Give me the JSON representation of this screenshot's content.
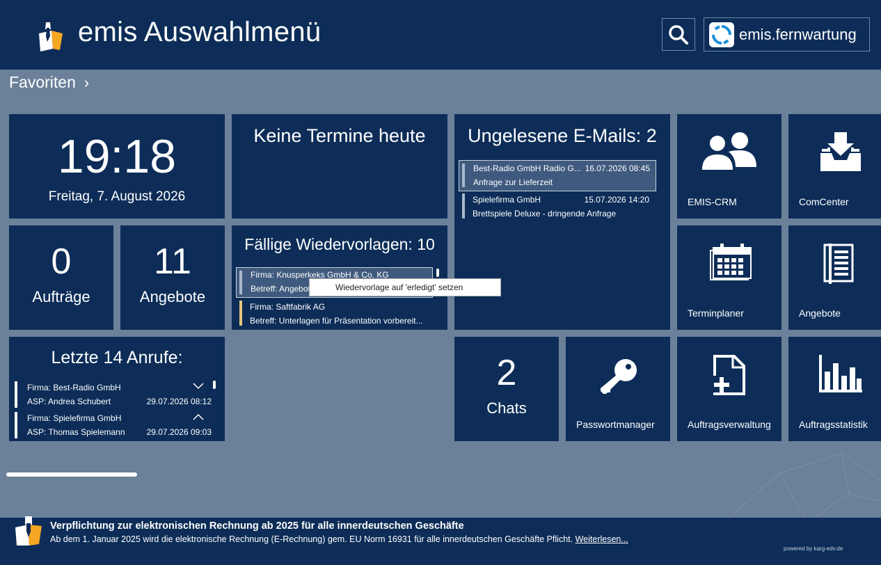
{
  "header": {
    "title": "emis Auswahlmenü",
    "remote_label": "emis.fernwartung"
  },
  "favorites": {
    "label": "Favoriten",
    "chevron": "›"
  },
  "clock": {
    "time": "19:18",
    "date": "Freitag, 7. August 2026"
  },
  "appointments": {
    "title": "Keine Termine heute"
  },
  "emails": {
    "title": "Ungelesene E-Mails: 2",
    "items": [
      {
        "sender": "Best-Radio GmbH Radio G...",
        "date": "16.07.2026 08:45",
        "subject": "Anfrage zur Lieferzeit"
      },
      {
        "sender": "Spielefirma GmbH",
        "date": "15.07.2026 14:20",
        "subject": "Brettspiele Deluxe - dringende Anfrage"
      }
    ]
  },
  "orders": {
    "count": "0",
    "label": "Aufträge"
  },
  "offers": {
    "count": "11",
    "label": "Angebote"
  },
  "followups": {
    "title": "Fällige Wiedervorlagen: 10",
    "items": [
      {
        "company": "Firma: Knusperkeks GmbH & Co. KG",
        "subject": "Betreff: Angebot"
      },
      {
        "company": "Firma: Saftfabrik AG",
        "subject": "Betreff: Unterlagen für Präsentation vorbereit..."
      }
    ],
    "context_menu": "Wiedervorlage auf 'erledigt' setzen"
  },
  "calls": {
    "title": "Letzte 14 Anrufe:",
    "items": [
      {
        "company": "Firma: Best-Radio GmbH",
        "contact": "ASP: Andrea Schubert",
        "date": "29.07.2026 08:12"
      },
      {
        "company": "Firma: Spielefirma GmbH",
        "contact": "ASP: Thomas Spielemann",
        "date": "29.07.2026 09:03"
      }
    ]
  },
  "chats": {
    "count": "2",
    "label": "Chats"
  },
  "apps": {
    "crm": "EMIS-CRM",
    "comcenter": "ComCenter",
    "planner": "Terminplaner",
    "offers": "Angebote",
    "passwords": "Passwortmanager",
    "order_mgmt": "Auftragsverwaltung",
    "order_stats": "Auftragsstatistik"
  },
  "footer": {
    "title": "Verpflichtung zur elektronischen Rechnung ab 2025 für alle innerdeutschen Geschäfte",
    "text": "Ab dem 1. Januar 2025 wird die  elektronische Rechnung (E-Rechnung) gem. EU Norm 16931 für alle innerdeutschen Geschäfte Pflicht.",
    "link": "Weiterlesen...",
    "powered": "powered by karg-edv.de"
  },
  "colors": {
    "tile": "#0d2d58",
    "background": "#6b8099",
    "accent_orange": "#f5a623",
    "highlight": "#e8c77a"
  }
}
